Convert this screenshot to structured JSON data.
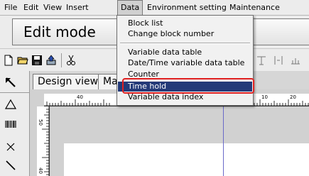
{
  "menubar": {
    "items": [
      "File",
      "Edit",
      "View",
      "Insert",
      "Data",
      "Environment setting",
      "Maintenance"
    ]
  },
  "title": "Edit mode",
  "tabs": [
    "Design view",
    "Ma"
  ],
  "ruler": {
    "h_labels": [
      "40",
      "10",
      "20"
    ],
    "v_labels": [
      "50",
      "40"
    ]
  },
  "dropdown": {
    "items": [
      "Block list",
      "Change block number",
      "Variable data table",
      "Date/Time variable data table",
      "Counter",
      "Time hold",
      "Variable data index"
    ],
    "highlighted": "Time hold",
    "highlight_color": "#243a78",
    "callout_color": "#e02020"
  },
  "icons": {
    "toolbar": [
      "new-file-icon",
      "open-folder-icon",
      "save-icon",
      "transfer-icon",
      "cut-icon"
    ],
    "lefttools": [
      "select-arrow-icon",
      "triangle-icon",
      "barcode-icon",
      "cross-icon",
      "line-icon"
    ]
  }
}
